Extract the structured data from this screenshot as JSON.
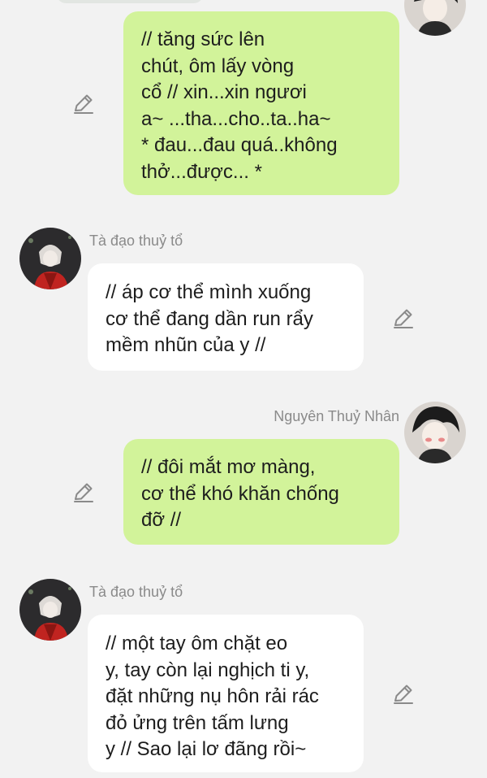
{
  "colors": {
    "background": "#f2f2f2",
    "outgoing_bubble": "#d2f39a",
    "incoming_bubble": "#ffffff",
    "sender_name": "#8a8a8a"
  },
  "messages": [
    {
      "direction": "outgoing",
      "sender": "",
      "lines": [
        "// tăng sức lên",
        "chút, ôm lấy vòng",
        "cổ // xin...xin ngươi",
        "a~ ...tha...cho..ta..ha~",
        "* đau...đau quá..không",
        "thở...được... *"
      ],
      "icon": "pencil-edit-icon"
    },
    {
      "direction": "incoming",
      "sender": "Tà đạo thuỷ tổ",
      "lines": [
        "// áp cơ thể mình xuống",
        "cơ thể đang dần run rẩy",
        "mềm nhũn của y //"
      ],
      "icon": "pencil-edit-icon"
    },
    {
      "direction": "outgoing",
      "sender": "Nguyên Thuỷ Nhân",
      "lines": [
        "// đôi mắt mơ màng,",
        "cơ thể khó khăn chống",
        "đỡ //"
      ],
      "icon": "pencil-edit-icon"
    },
    {
      "direction": "incoming",
      "sender": "Tà đạo thuỷ tổ",
      "lines": [
        "// một tay ôm chặt eo",
        "y, tay còn lại nghịch ti y,",
        "đặt những nụ hôn rải rác",
        "đỏ ửng trên tấm lưng",
        "y // Sao lại lơ đãng rồi~"
      ],
      "icon": "pencil-edit-icon"
    }
  ]
}
